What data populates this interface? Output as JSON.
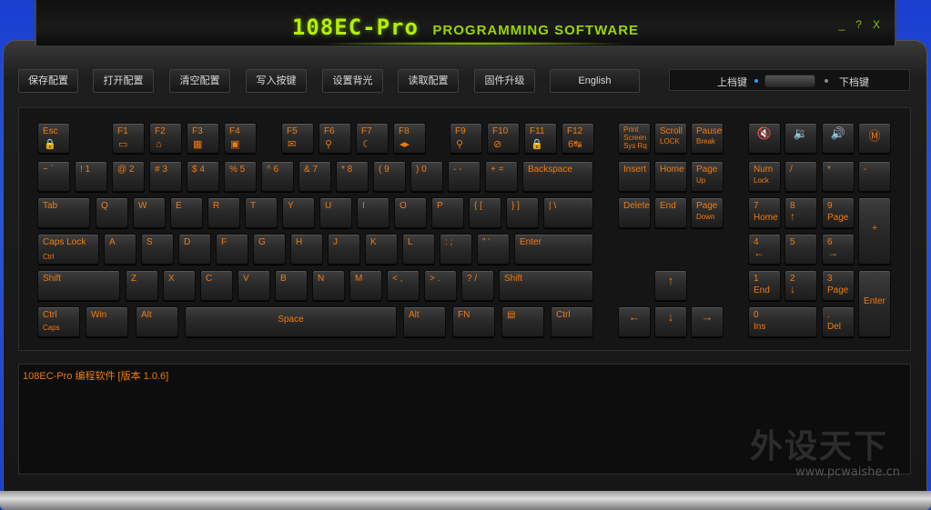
{
  "title": {
    "main": "108EC-Pro",
    "sub": "PROGRAMMING SOFTWARE"
  },
  "window_buttons": [
    "_",
    "?",
    "X"
  ],
  "toolbar": {
    "buttons": [
      "保存配置",
      "打开配置",
      "清空配置",
      "写入按键",
      "设置背光",
      "读取配置",
      "固件升级",
      "English"
    ]
  },
  "layer": {
    "upper": "上档键",
    "lower": "下档键"
  },
  "keys": {
    "esc": "Esc",
    "f1": "F1",
    "f2": "F2",
    "f3": "F3",
    "f4": "F4",
    "f5": "F5",
    "f6": "F6",
    "f7": "F7",
    "f8": "F8",
    "f9": "F9",
    "f10": "F10",
    "f11": "F11",
    "f12": "F12",
    "print": "Print",
    "print2": "Screen",
    "print3": "Sys  Rq",
    "scroll": "Scroll",
    "scroll2": "LOCK",
    "pause": "Pause",
    "pause2": "Break",
    "tilde": "~  `",
    "n1": "!  1",
    "n2": "@  2",
    "n3": "#  3",
    "n4": "$  4",
    "n5": "%  5",
    "n6": "^  6",
    "n7": "&  7",
    "n8": "*  8",
    "n9": "(  9",
    "n0": ")  0",
    "minus": "-  -",
    "equal": "+  =",
    "backspace": "Backspace",
    "insert": "Insert",
    "home": "Home",
    "pageup": "Page",
    "pageup2": "Up",
    "numlock": "Num",
    "numlock2": "Lock",
    "npdiv": "/",
    "npmul": "*",
    "npsub": "-",
    "tab": "Tab",
    "q": "Q",
    "w": "W",
    "e": "E",
    "r": "R",
    "t": "T",
    "y": "Y",
    "u": "U",
    "i": "I",
    "o": "O",
    "p": "P",
    "lbr": "{  [",
    "rbr": "}  ]",
    "bsl": "|  \\",
    "delete": "Delete",
    "end": "End",
    "pagedown": "Page",
    "pagedown2": "Down",
    "np7": "7",
    "np7b": "Home",
    "np8": "8",
    "np9": "9",
    "np9b": "Page",
    "npadd": "+",
    "caps": "Caps Lock",
    "caps2": "Ctrl",
    "a": "A",
    "s": "S",
    "d": "D",
    "f": "F",
    "g": "G",
    "h": "H",
    "j": "J",
    "k": "K",
    "l": "L",
    "semi": ":  ;",
    "quote": "\"  '",
    "enter": "Enter",
    "np4": "4",
    "np5": "5",
    "np6": "6",
    "lshift": "Shift",
    "z": "Z",
    "x": "X",
    "c": "C",
    "v": "V",
    "b": "B",
    "n": "N",
    "m": "M",
    "comma": "<  ,",
    "period": ">  .",
    "slash": "?  /",
    "rshift": "Shift",
    "np1": "1",
    "np1b": "End",
    "np2": "2",
    "np3": "3",
    "np3b": "Page",
    "npenter": "Enter",
    "lctrl": "Ctrl",
    "lctrl2": "Caps",
    "win": "Win",
    "lalt": "Alt",
    "space": "Space",
    "ralt": "Alt",
    "fn": "FN",
    "rctrl": "Ctrl",
    "np0": "0",
    "np0b": "Ins",
    "npdot": ".",
    "npdotb": "Del"
  },
  "log": {
    "line": "108EC-Pro 编程软件 [版本 1.0.6]"
  },
  "watermark": {
    "cn": "外设天下",
    "url": "www.pcwaishe.cn"
  },
  "colors": {
    "accent": "#f07a10",
    "title": "#b5f000",
    "background": "#1a3fd0"
  }
}
